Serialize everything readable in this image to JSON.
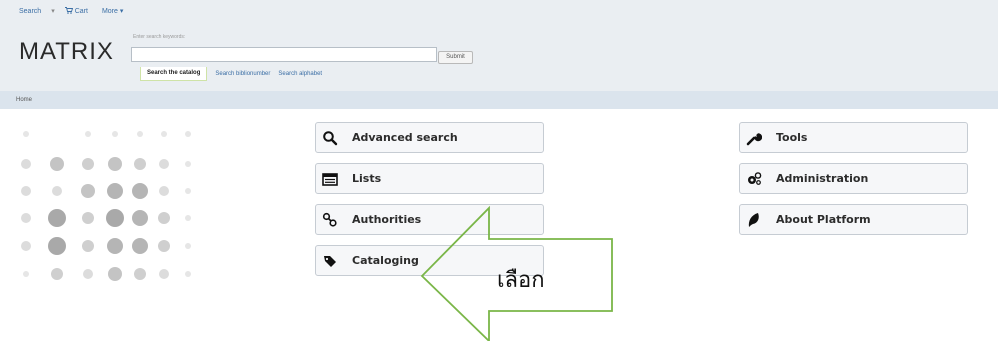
{
  "topnav": {
    "search_label": "Search",
    "separator": "▾",
    "cart_label": "Cart",
    "more_label": "More ▾"
  },
  "header": {
    "logo_text": "MATRIX",
    "search_hint": "Enter search keywords:",
    "search_value": "",
    "submit_label": "Submit"
  },
  "search_tabs": [
    {
      "label": "Search the catalog"
    },
    {
      "label": "Search biblionumber"
    },
    {
      "label": "Search alphabet"
    }
  ],
  "breadcrumb": {
    "home": "Home"
  },
  "left_menu": [
    {
      "label": "Advanced search",
      "icon": "search-icon"
    },
    {
      "label": "Lists",
      "icon": "list-icon"
    },
    {
      "label": "Authorities",
      "icon": "link-icon"
    },
    {
      "label": "Cataloging",
      "icon": "tag-icon"
    }
  ],
  "right_menu": [
    {
      "label": "Tools",
      "icon": "wrench-icon"
    },
    {
      "label": "Administration",
      "icon": "gears-icon"
    },
    {
      "label": "About Platform",
      "icon": "koha-leaf-icon"
    }
  ],
  "annotation": {
    "text": "เลือก",
    "arrow_color": "#7ab648"
  }
}
